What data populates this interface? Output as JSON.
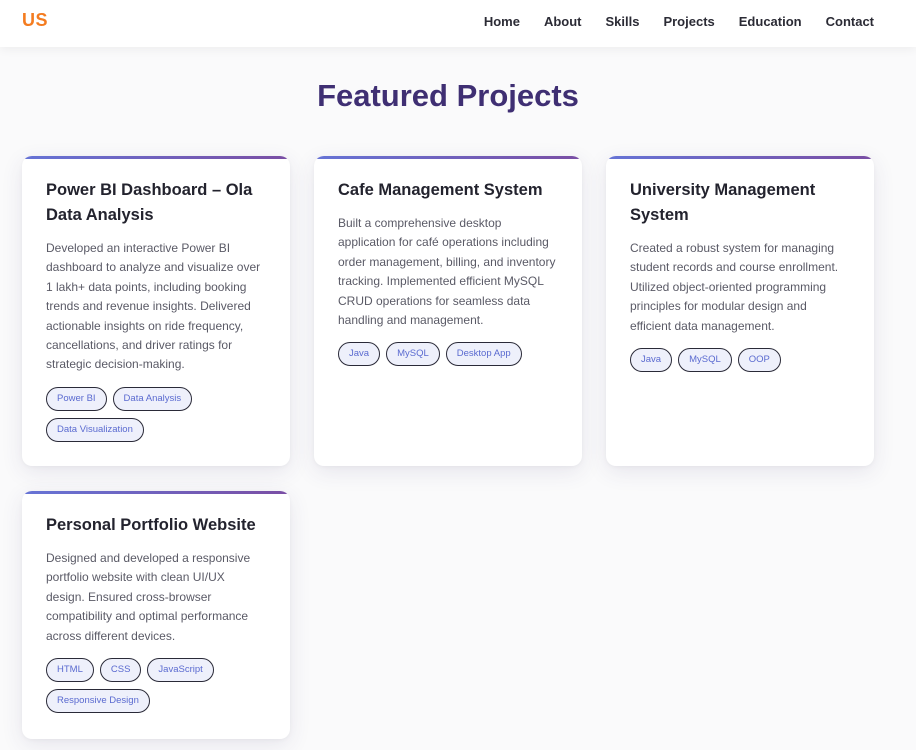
{
  "nav": {
    "logo": "US",
    "links": [
      "Home",
      "About",
      "Skills",
      "Projects",
      "Education",
      "Contact"
    ]
  },
  "section": {
    "title": "Featured Projects"
  },
  "projects": [
    {
      "title": "Power BI Dashboard – Ola Data Analysis",
      "description": "Developed an interactive Power BI dashboard to analyze and visualize over 1 lakh+ data points, including booking trends and revenue insights. Delivered actionable insights on ride frequency, cancellations, and driver ratings for strategic decision-making.",
      "tags": [
        "Power BI",
        "Data Analysis",
        "Data Visualization"
      ]
    },
    {
      "title": "Cafe Management System",
      "description": "Built a comprehensive desktop application for café operations including order management, billing, and inventory tracking. Implemented efficient MySQL CRUD operations for seamless data handling and management.",
      "tags": [
        "Java",
        "MySQL",
        "Desktop App"
      ]
    },
    {
      "title": "University Management System",
      "description": "Created a robust system for managing student records and course enrollment. Utilized object-oriented programming principles for modular design and efficient data management.",
      "tags": [
        "Java",
        "MySQL",
        "OOP"
      ]
    },
    {
      "title": "Personal Portfolio Website",
      "description": "Designed and developed a responsive portfolio website with clean UI/UX design. Ensured cross-browser compatibility and optimal performance across different devices.",
      "tags": [
        "HTML",
        "CSS",
        "JavaScript",
        "Responsive Design"
      ]
    }
  ],
  "colors": {
    "logo": "#f47c20",
    "title": "#3f2f73",
    "tag_text": "#5a6ad0",
    "accent_start": "#6674d6",
    "accent_end": "#7a4ea4"
  }
}
